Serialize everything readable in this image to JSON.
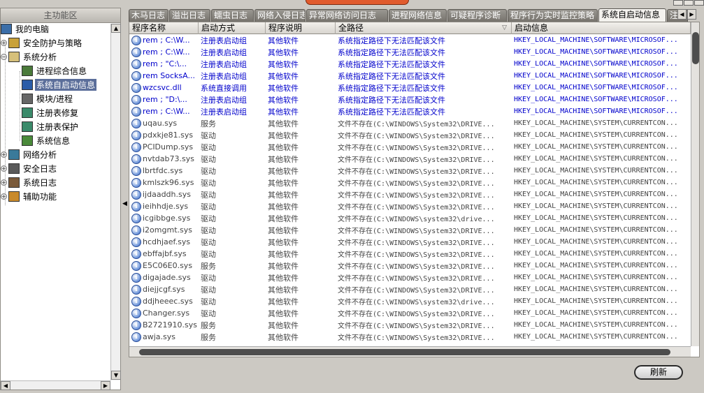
{
  "left_panel": {
    "title": "主功能区",
    "tree": [
      {
        "label": "我的电脑",
        "icon": "computer-icon",
        "level": 0,
        "expander": ""
      },
      {
        "label": "安全防护与策略",
        "icon": "policy-icon",
        "level": 1,
        "expander": "+"
      },
      {
        "label": "系统分析",
        "icon": "analysis-folder-icon",
        "level": 1,
        "expander": "−"
      },
      {
        "label": "进程综合信息",
        "icon": "process-info-icon",
        "level": 2,
        "expander": ""
      },
      {
        "label": "系统自启动信息",
        "icon": "autostart-icon",
        "level": 2,
        "expander": "",
        "selected": true
      },
      {
        "label": "模块/进程",
        "icon": "module-icon",
        "level": 2,
        "expander": ""
      },
      {
        "label": "注册表修复",
        "icon": "registry-repair-icon",
        "level": 2,
        "expander": ""
      },
      {
        "label": "注册表保护",
        "icon": "registry-protect-icon",
        "level": 2,
        "expander": ""
      },
      {
        "label": "系统信息",
        "icon": "system-info-icon",
        "level": 2,
        "expander": ""
      },
      {
        "label": "网络分析",
        "icon": "network-icon",
        "level": 1,
        "expander": "+"
      },
      {
        "label": "安全日志",
        "icon": "security-log-icon",
        "level": 1,
        "expander": "+"
      },
      {
        "label": "系统日志",
        "icon": "system-log-icon",
        "level": 1,
        "expander": "+"
      },
      {
        "label": "辅助功能",
        "icon": "assist-icon",
        "level": 1,
        "expander": "+"
      }
    ]
  },
  "tabs": [
    {
      "label": "木马日志"
    },
    {
      "label": "溢出日志"
    },
    {
      "label": "蠕虫日志"
    },
    {
      "label": "网络入侵日志"
    },
    {
      "label": "异常网络访问日志"
    },
    {
      "label": "进程网络信息"
    },
    {
      "label": "可疑程序诊断"
    },
    {
      "label": "程序行为实时监控策略"
    },
    {
      "label": "系统自启动信息",
      "active": true
    },
    {
      "label": "注"
    }
  ],
  "table": {
    "columns": [
      "程序名称",
      "启动方式",
      "程序说明",
      "全路径",
      "启动信息"
    ],
    "rows": [
      {
        "name": "rem ; C:\\W...",
        "method": "注册表启动组",
        "desc": "其他软件",
        "path": "系统指定路径下无法匹配该文件",
        "info": "HKEY_LOCAL_MACHINE\\SOFTWARE\\MICROSOF...",
        "style": "blue"
      },
      {
        "name": "rem ; C:\\W...",
        "method": "注册表启动组",
        "desc": "其他软件",
        "path": "系统指定路径下无法匹配该文件",
        "info": "HKEY_LOCAL_MACHINE\\SOFTWARE\\MICROSOF...",
        "style": "blue"
      },
      {
        "name": "rem ; \"C:\\...",
        "method": "注册表启动组",
        "desc": "其他软件",
        "path": "系统指定路径下无法匹配该文件",
        "info": "HKEY_LOCAL_MACHINE\\SOFTWARE\\MICROSOF...",
        "style": "blue"
      },
      {
        "name": "rem SocksA...",
        "method": "注册表启动组",
        "desc": "其他软件",
        "path": "系统指定路径下无法匹配该文件",
        "info": "HKEY_LOCAL_MACHINE\\SOFTWARE\\MICROSOF...",
        "style": "blue"
      },
      {
        "name": "wzcsvc.dll",
        "method": "系统直接调用",
        "desc": "其他软件",
        "path": "系统指定路径下无法匹配该文件",
        "info": "HKEY_LOCAL_MACHINE\\SOFTWARE\\MICROSOF...",
        "style": "blue"
      },
      {
        "name": "rem ; \"D:\\...",
        "method": "注册表启动组",
        "desc": "其他软件",
        "path": "系统指定路径下无法匹配该文件",
        "info": "HKEY_LOCAL_MACHINE\\SOFTWARE\\MICROSOF...",
        "style": "blue"
      },
      {
        "name": "rem ; C:\\W...",
        "method": "注册表启动组",
        "desc": "其他软件",
        "path": "系统指定路径下无法匹配该文件",
        "info": "HKEY_LOCAL_MACHINE\\SOFTWARE\\MICROSOF...",
        "style": "blue"
      },
      {
        "name": "uqau.sys",
        "method": "服务",
        "desc": "其他软件",
        "path": "文件不存在(C:\\WINDOWS\\System32\\DRIVE...",
        "info": "HKEY_LOCAL_MACHINE\\SYSTEM\\CURRENTCON...",
        "style": "gray"
      },
      {
        "name": "pdxkje81.sys",
        "method": "驱动",
        "desc": "其他软件",
        "path": "文件不存在(C:\\WINDOWS\\System32\\DRIVE...",
        "info": "HKEY_LOCAL_MACHINE\\SYSTEM\\CURRENTCON...",
        "style": "gray"
      },
      {
        "name": "PCIDump.sys",
        "method": "驱动",
        "desc": "其他软件",
        "path": "文件不存在(C:\\WINDOWS\\System32\\DRIVE...",
        "info": "HKEY_LOCAL_MACHINE\\SYSTEM\\CURRENTCON...",
        "style": "gray"
      },
      {
        "name": "nvtdab73.sys",
        "method": "驱动",
        "desc": "其他软件",
        "path": "文件不存在(C:\\WINDOWS\\System32\\DRIVE...",
        "info": "HKEY_LOCAL_MACHINE\\SYSTEM\\CURRENTCON...",
        "style": "gray"
      },
      {
        "name": "lbrtfdc.sys",
        "method": "驱动",
        "desc": "其他软件",
        "path": "文件不存在(C:\\WINDOWS\\System32\\DRIVE...",
        "info": "HKEY_LOCAL_MACHINE\\SYSTEM\\CURRENTCON...",
        "style": "gray"
      },
      {
        "name": "kmlszk96.sys",
        "method": "驱动",
        "desc": "其他软件",
        "path": "文件不存在(C:\\WINDOWS\\System32\\DRIVE...",
        "info": "HKEY_LOCAL_MACHINE\\SYSTEM\\CURRENTCON...",
        "style": "gray"
      },
      {
        "name": "ijdaaddh.sys",
        "method": "驱动",
        "desc": "其他软件",
        "path": "文件不存在(C:\\WINDOWS\\System32\\DRIVE...",
        "info": "HKEY_LOCAL_MACHINE\\SYSTEM\\CURRENTCON...",
        "style": "gray"
      },
      {
        "name": "ieihhdje.sys",
        "method": "驱动",
        "desc": "其他软件",
        "path": "文件不存在(C:\\WINDOWS\\System32\\DRIVE...",
        "info": "HKEY_LOCAL_MACHINE\\SYSTEM\\CURRENTCON...",
        "style": "gray"
      },
      {
        "name": "icgibbge.sys",
        "method": "驱动",
        "desc": "其他软件",
        "path": "文件不存在(C:\\WINDOWS\\system32\\drive...",
        "info": "HKEY_LOCAL_MACHINE\\SYSTEM\\CURRENTCON...",
        "style": "gray"
      },
      {
        "name": "i2omgmt.sys",
        "method": "驱动",
        "desc": "其他软件",
        "path": "文件不存在(C:\\WINDOWS\\System32\\DRIVE...",
        "info": "HKEY_LOCAL_MACHINE\\SYSTEM\\CURRENTCON...",
        "style": "gray"
      },
      {
        "name": "hcdhjaef.sys",
        "method": "驱动",
        "desc": "其他软件",
        "path": "文件不存在(C:\\WINDOWS\\System32\\DRIVE...",
        "info": "HKEY_LOCAL_MACHINE\\SYSTEM\\CURRENTCON...",
        "style": "gray"
      },
      {
        "name": "ebffajbf.sys",
        "method": "驱动",
        "desc": "其他软件",
        "path": "文件不存在(C:\\WINDOWS\\System32\\DRIVE...",
        "info": "HKEY_LOCAL_MACHINE\\SYSTEM\\CURRENTCON...",
        "style": "gray"
      },
      {
        "name": "E5C06E0.sys",
        "method": "服务",
        "desc": "其他软件",
        "path": "文件不存在(C:\\WINDOWS\\System32\\DRIVE...",
        "info": "HKEY_LOCAL_MACHINE\\SYSTEM\\CURRENTCON...",
        "style": "gray"
      },
      {
        "name": "digajade.sys",
        "method": "驱动",
        "desc": "其他软件",
        "path": "文件不存在(C:\\WINDOWS\\System32\\DRIVE...",
        "info": "HKEY_LOCAL_MACHINE\\SYSTEM\\CURRENTCON...",
        "style": "gray"
      },
      {
        "name": "diejjcgf.sys",
        "method": "驱动",
        "desc": "其他软件",
        "path": "文件不存在(C:\\WINDOWS\\System32\\DRIVE...",
        "info": "HKEY_LOCAL_MACHINE\\SYSTEM\\CURRENTCON...",
        "style": "gray"
      },
      {
        "name": "ddjheeec.sys",
        "method": "驱动",
        "desc": "其他软件",
        "path": "文件不存在(C:\\WINDOWS\\system32\\drive...",
        "info": "HKEY_LOCAL_MACHINE\\SYSTEM\\CURRENTCON...",
        "style": "gray"
      },
      {
        "name": "Changer.sys",
        "method": "驱动",
        "desc": "其他软件",
        "path": "文件不存在(C:\\WINDOWS\\System32\\DRIVE...",
        "info": "HKEY_LOCAL_MACHINE\\SYSTEM\\CURRENTCON...",
        "style": "gray"
      },
      {
        "name": "B2721910.sys",
        "method": "服务",
        "desc": "其他软件",
        "path": "文件不存在(C:\\WINDOWS\\System32\\DRIVE...",
        "info": "HKEY_LOCAL_MACHINE\\SYSTEM\\CURRENTCON...",
        "style": "gray"
      },
      {
        "name": "awja.sys",
        "method": "服务",
        "desc": "其他软件",
        "path": "文件不存在(C:\\WINDOWS\\System32\\DRIVE...",
        "info": "HKEY_LOCAL_MACHINE\\SYSTEM\\CURRENTCON...",
        "style": "gray"
      }
    ]
  },
  "bottom": {
    "refresh_label": "刷新"
  },
  "colors": {
    "selected_bg": "#5b6e9a",
    "blue_text": "#0000cc",
    "accent_orange": "#e05a2c"
  }
}
